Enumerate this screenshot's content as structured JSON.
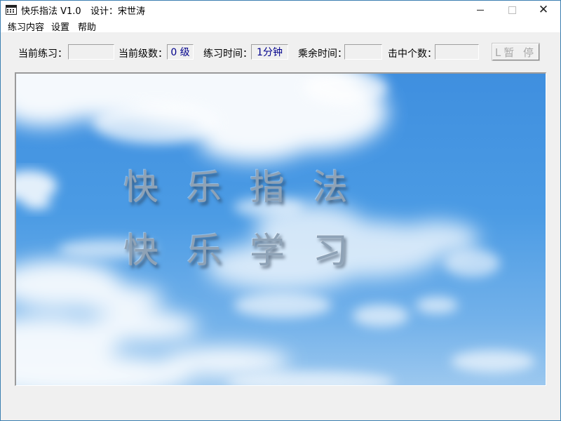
{
  "window": {
    "title": "快乐指法 V1.0",
    "designer": "设计：宋世涛",
    "icons": {
      "app": "keyboard-icon",
      "minimize": "minimize-icon",
      "maximize": "maximize-icon",
      "close": "close-icon"
    },
    "close_glyph": "✕"
  },
  "menu": {
    "items": [
      "练习内容",
      "设置",
      "帮助"
    ]
  },
  "status": {
    "current_practice_label": "当前练习：",
    "current_practice_value": "",
    "current_level_label": "当前级数：",
    "current_level_value": "0 级",
    "practice_time_label": "练习时间：",
    "practice_time_value": "1分钟",
    "remaining_time_label": "乘余时间：",
    "remaining_time_value": "",
    "hits_label": "击中个数：",
    "hits_value": ""
  },
  "pause_button": {
    "label": "L暂 停",
    "enabled": false
  },
  "banner": {
    "line1": "快乐指法",
    "line2": "快乐学习"
  },
  "colors": {
    "sky_top": "#3f8fdf",
    "sky_bottom": "#9cc8ef",
    "value_text": "#00008b",
    "disabled_text": "#a8a8a8"
  }
}
